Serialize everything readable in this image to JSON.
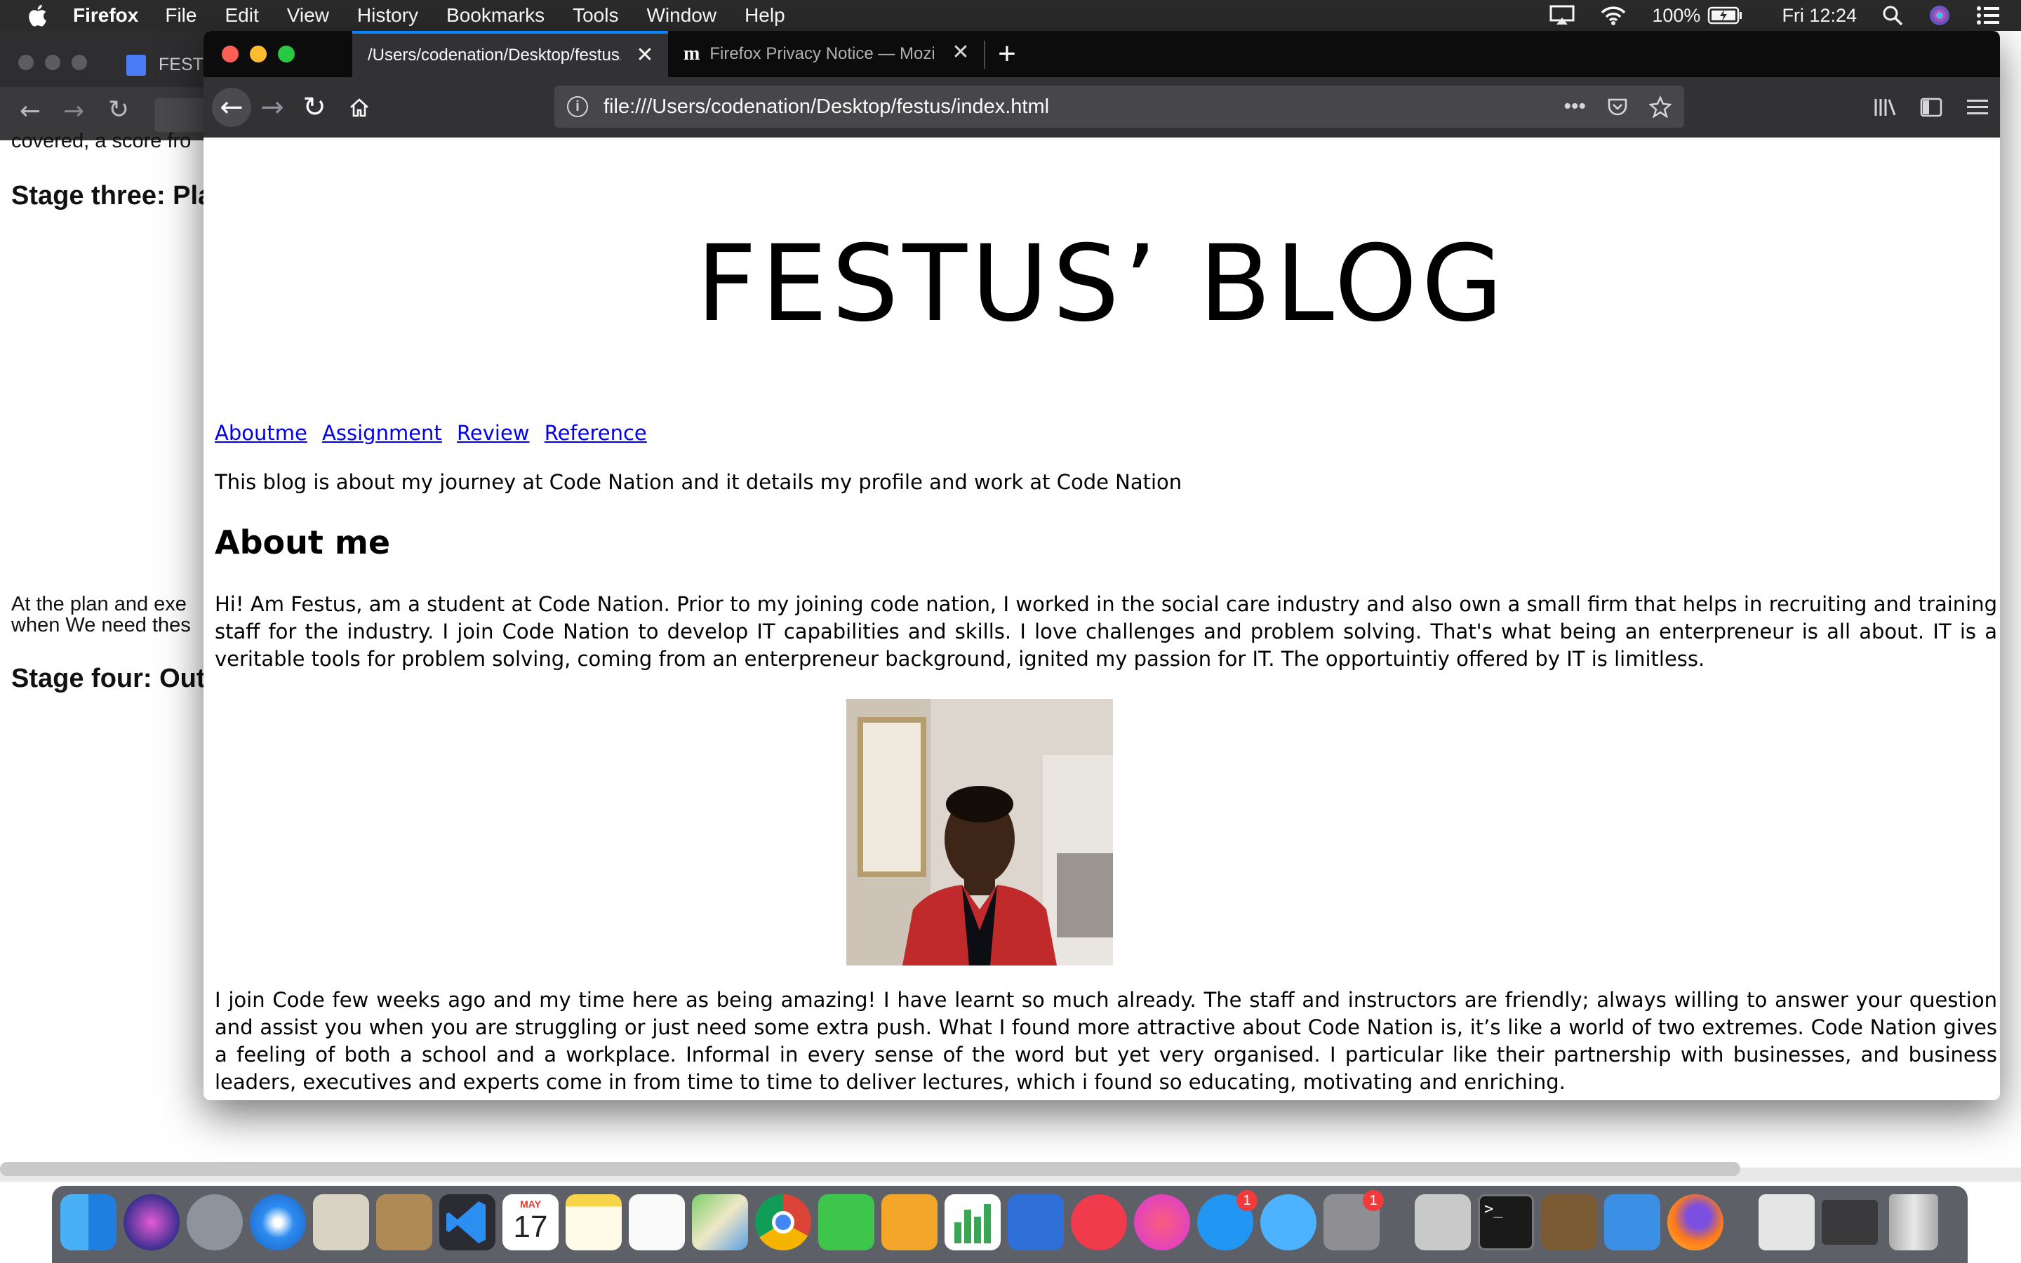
{
  "menubar": {
    "app": "Firefox",
    "items": [
      "File",
      "Edit",
      "View",
      "History",
      "Bookmarks",
      "Tools",
      "Window",
      "Help"
    ],
    "battery": "100%",
    "clock": "Fri 12:24"
  },
  "background_window": {
    "tab_label": "FEST",
    "line_top": "covered, a score fro",
    "heading_stage_three": "Stage three: Pla",
    "para_plan_1": "At the plan and exe",
    "para_plan_2": "when We need thes",
    "heading_stage_four": "Stage four: Out"
  },
  "tabs": [
    {
      "label": "/Users/codenation/Desktop/festus/index.html",
      "active": true
    },
    {
      "label": "Firefox Privacy Notice — Mozilla",
      "active": false,
      "icon": "m"
    }
  ],
  "url": "file:///Users/codenation/Desktop/festus/index.html",
  "page": {
    "title": "FESTUS’ BLOG",
    "nav_links": [
      "Aboutme",
      "Assignment",
      "Review",
      "Reference"
    ],
    "intro": "This blog is about my journey at Code Nation and it details my profile and work at Code Nation",
    "about_heading": "About me",
    "about_para": "Hi! Am Festus, am a student at Code Nation. Prior to my joining code nation, I worked in the social care industry and also own a small firm that helps in recruiting and training staff for the industry. I join Code Nation to develop IT capabilities and skills. I love challenges and problem solving. That's what being an enterpreneur is all about. IT is a veritable tools for problem solving, coming from an enterpreneur background, ignited my passion for IT. The opportuintiy offered by IT is limitless.",
    "journey_para": "I join Code few weeks ago and my time here as being amazing! I have learnt so much already. The staff and instructors are friendly; always willing to answer your question and assist you when you are struggling or just need some extra push. What I found more attractive about Code Nation is, it’s like a world of two extremes. Code Nation gives a feeling of both a school and a workplace. Informal in every sense of the word but yet very organised. I particular like their partnership with businesses, and business leaders, executives and experts come in from time to time to deliver lectures, which i found so educating, motivating and enriching."
  },
  "dock": {
    "apps": [
      "Finder",
      "Siri",
      "Launchpad",
      "Safari",
      "Mail",
      "Contacts",
      "VS Code",
      "Calendar",
      "Notes",
      "Reminders",
      "Maps",
      "Chrome",
      "FaceTime",
      "Pages",
      "Numbers",
      "Keynote",
      "News",
      "iTunes",
      "App Store",
      "Messages",
      "System Preferences",
      "Keychain",
      "Terminal",
      "GarageBand",
      "Xcode",
      "Firefox",
      "Preview",
      "Server",
      "Trash"
    ],
    "calendar_month": "MAY",
    "calendar_day": "17",
    "app_store_badge": "1",
    "prefs_badge": "1"
  },
  "colors": {
    "link": "#0000ee",
    "tab_accent": "#0a84ff",
    "toolbar": "#323234",
    "tabbar": "#0c0c0d"
  }
}
